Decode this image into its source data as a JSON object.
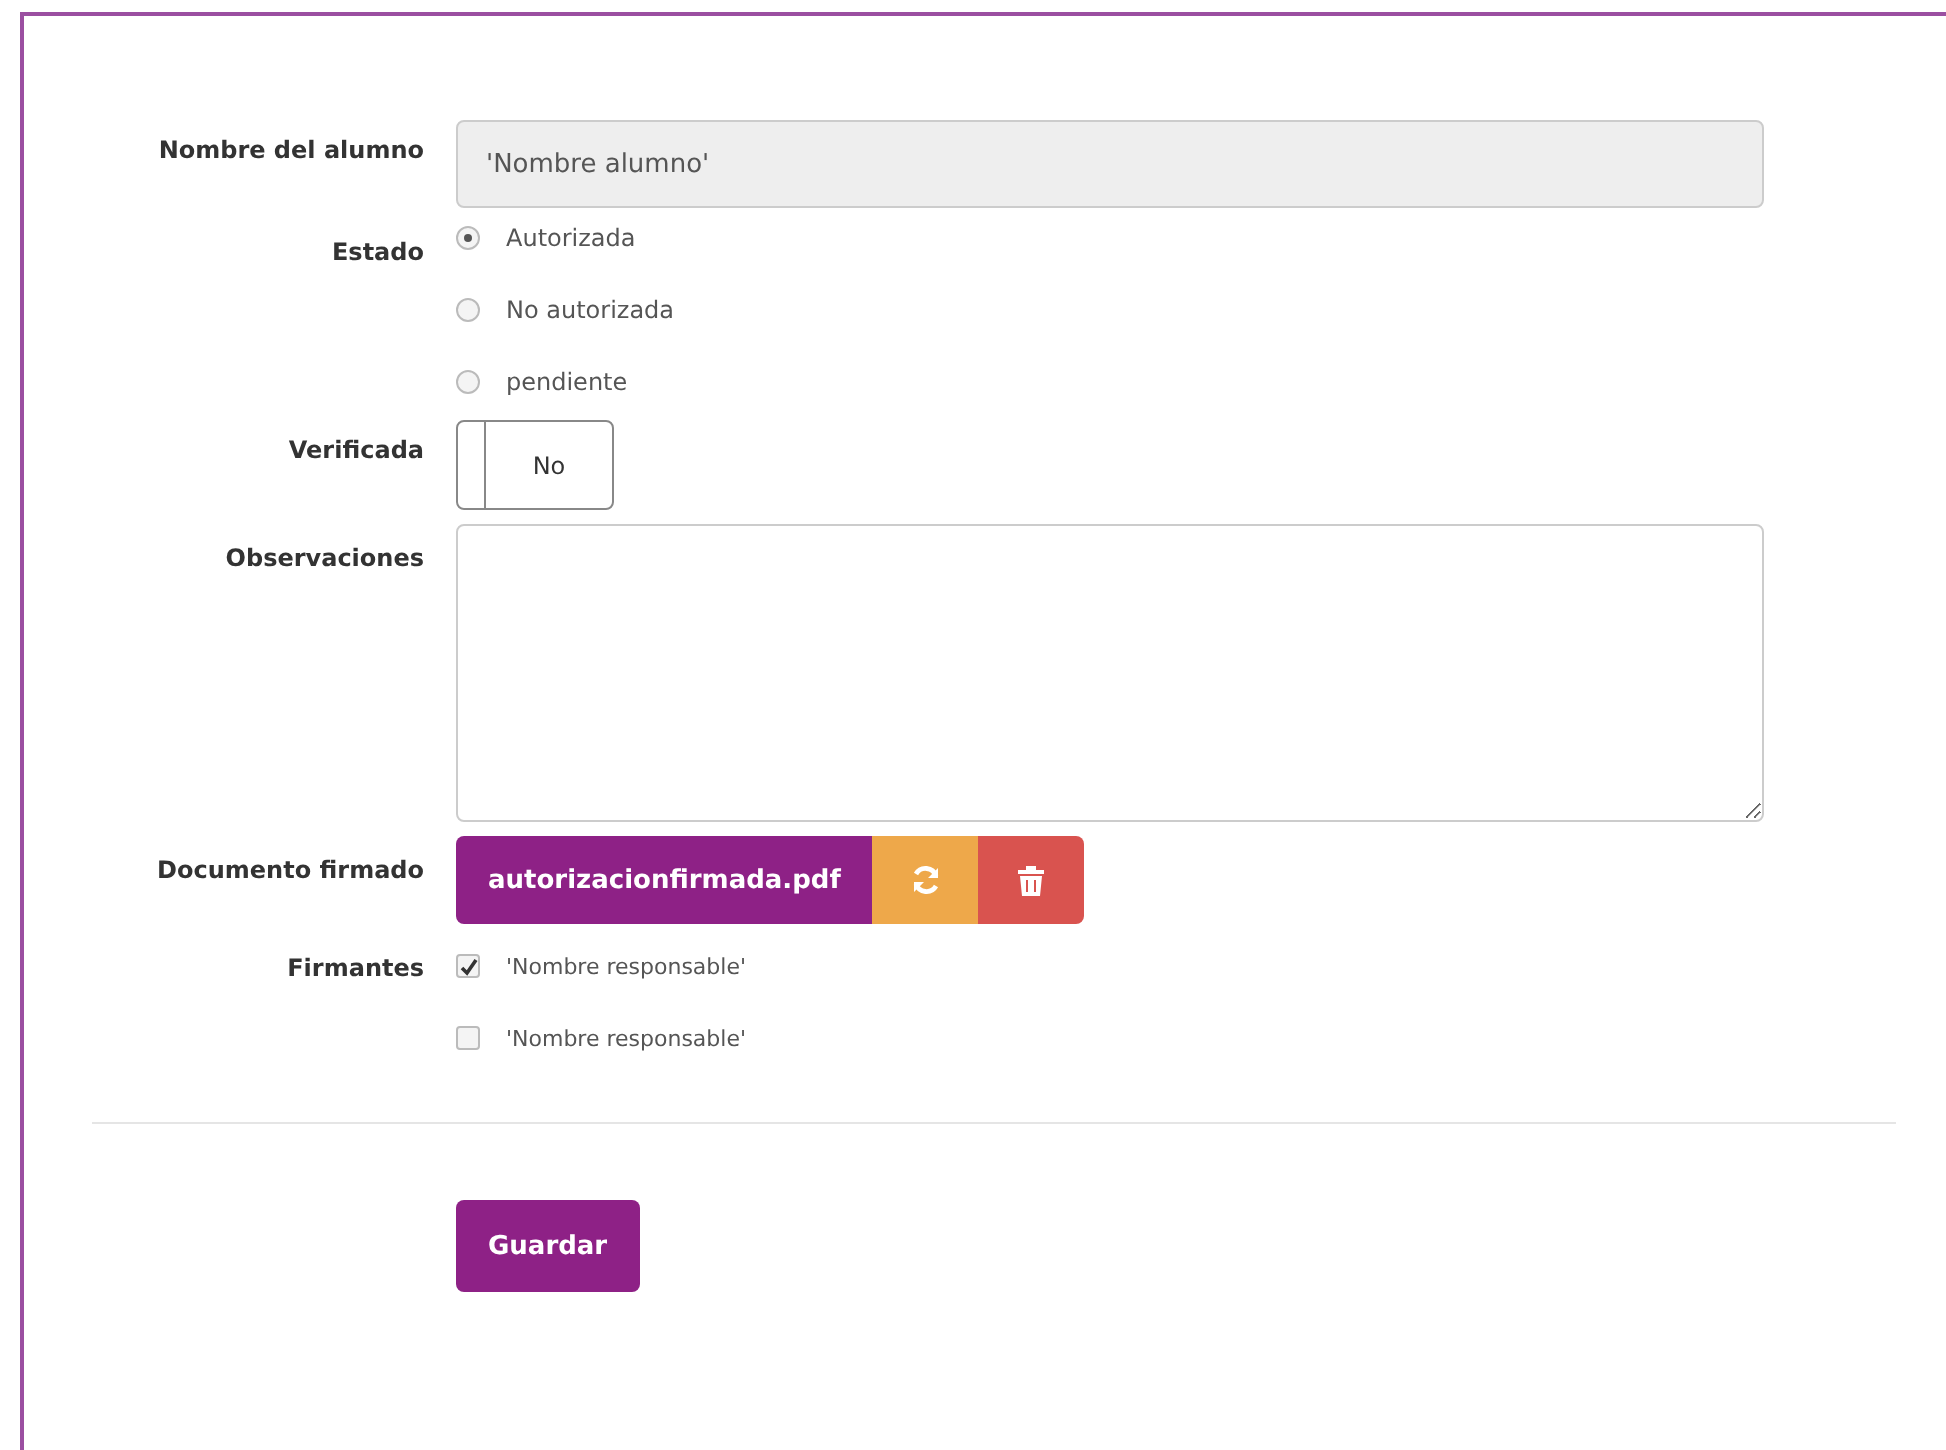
{
  "form": {
    "student": {
      "label": "Nombre del alumno",
      "value": "'Nombre alumno'",
      "disabled": true
    },
    "status": {
      "label": "Estado",
      "options": [
        {
          "label": "Autorizada",
          "selected": true
        },
        {
          "label": "No autorizada",
          "selected": false
        },
        {
          "label": "pendiente",
          "selected": false
        }
      ]
    },
    "verified": {
      "label": "Verificada",
      "on": false,
      "text": "No"
    },
    "notes": {
      "label": "Observaciones"
    },
    "document": {
      "label": "Documento firmado",
      "file": "autorizacionfirmada.pdf"
    },
    "signers": {
      "label": "Firmantes",
      "items": [
        {
          "label": "'Nombre responsable'",
          "checked": true
        },
        {
          "label": "'Nombre responsable'",
          "checked": false
        }
      ]
    },
    "save": "Guardar"
  }
}
